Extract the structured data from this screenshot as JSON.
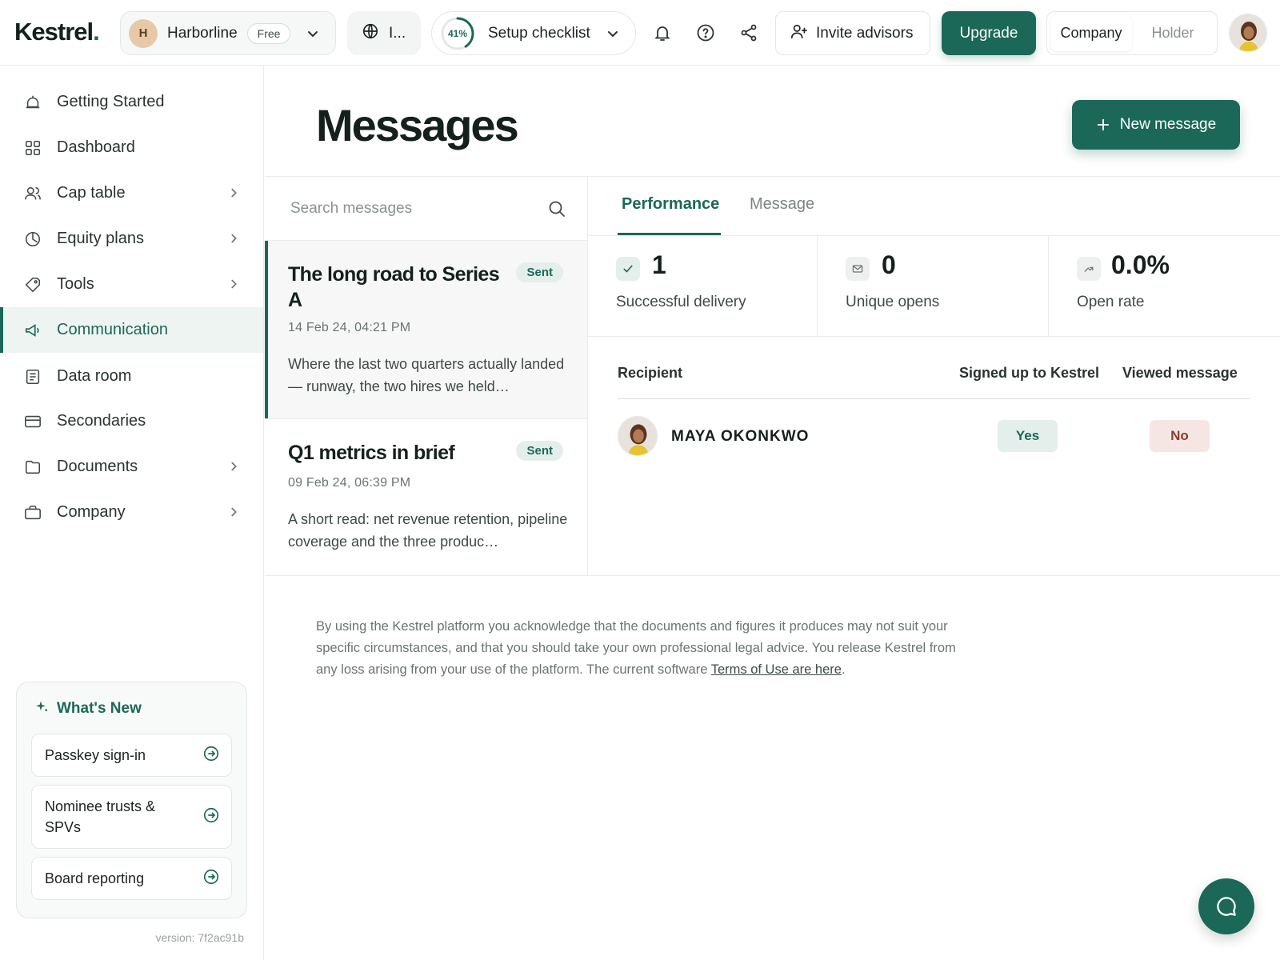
{
  "brand": {
    "logo_text": "Kestrel",
    "logo_dot": ".",
    "accent_color": "#1b6858"
  },
  "topbar": {
    "company": {
      "initial": "H",
      "name": "Harborline",
      "plan": "Free"
    },
    "locale_label": "I...",
    "setup": {
      "progress_percent": 41,
      "progress_label": "41%",
      "label": "Setup checklist"
    },
    "icons": [
      "bell-icon",
      "help-icon",
      "share-icon"
    ],
    "invite_label": "Invite advisors",
    "upgrade_label": "Upgrade",
    "view_toggle": {
      "options": [
        "Company",
        "Holder"
      ],
      "selected": "Company"
    }
  },
  "sidebar": {
    "items": [
      {
        "label": "Getting Started",
        "icon": "bell-icon",
        "has_children": false,
        "active": false
      },
      {
        "label": "Dashboard",
        "icon": "grid-icon",
        "has_children": false,
        "active": false
      },
      {
        "label": "Cap table",
        "icon": "users-icon",
        "has_children": true,
        "active": false
      },
      {
        "label": "Equity plans",
        "icon": "clock-icon",
        "has_children": true,
        "active": false
      },
      {
        "label": "Tools",
        "icon": "tag-icon",
        "has_children": true,
        "active": false
      },
      {
        "label": "Communication",
        "icon": "megaphone-icon",
        "has_children": false,
        "active": true
      },
      {
        "label": "Data room",
        "icon": "document-icon",
        "has_children": false,
        "active": false
      },
      {
        "label": "Secondaries",
        "icon": "card-icon",
        "has_children": false,
        "active": false
      },
      {
        "label": "Documents",
        "icon": "folder-icon",
        "has_children": true,
        "active": false
      },
      {
        "label": "Company",
        "icon": "briefcase-icon",
        "has_children": true,
        "active": false
      }
    ],
    "whats_new": {
      "title": "What's New",
      "items": [
        "Passkey sign-in",
        "Nominee trusts & SPVs",
        "Board reporting"
      ]
    },
    "version": "version: 7f2ac91b"
  },
  "main": {
    "title": "Messages",
    "new_message_label": "New message",
    "search": {
      "placeholder": "Search messages",
      "value": ""
    },
    "messages": [
      {
        "title": "The long road to Series A",
        "status": "Sent",
        "date": "14 Feb 24, 04:21 PM",
        "preview": "Where the last two quarters actually landed — runway, the two hires we held…",
        "selected": true
      },
      {
        "title": "Q1 metrics in brief",
        "status": "Sent",
        "date": "09 Feb 24, 06:39 PM",
        "preview": "A short read: net revenue retention, pipeline coverage and the three produc…",
        "selected": false
      }
    ],
    "detail": {
      "tabs": [
        "Performance",
        "Message"
      ],
      "active_tab": "Performance",
      "stats": [
        {
          "value": "1",
          "label": "Successful delivery",
          "icon": "check-icon"
        },
        {
          "value": "0",
          "label": "Unique opens",
          "icon": "mail-icon"
        },
        {
          "value": "0.0%",
          "label": "Open rate",
          "icon": "trend-up-icon"
        }
      ],
      "table": {
        "headers": [
          "Recipient",
          "Signed up to Kestrel",
          "Viewed message"
        ],
        "rows": [
          {
            "name": "MAYA OKONKWO",
            "signed_up": "Yes",
            "viewed": "No"
          }
        ]
      }
    },
    "disclaimer": {
      "text": "By using the Kestrel platform you acknowledge that the documents and figures it produces may not suit your specific circumstances, and that you should take your own professional legal advice. You release Kestrel from any loss arising from your use of the platform. The current software ",
      "link": "Terms of Use are here",
      "end": "."
    }
  }
}
